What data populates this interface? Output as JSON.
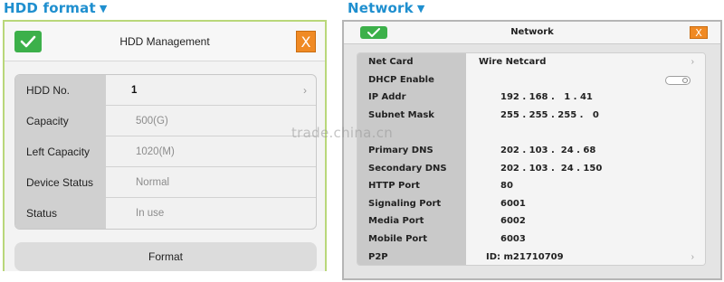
{
  "captions": {
    "hdd": "HDD format",
    "network": "Network",
    "arrow_glyph": "▼"
  },
  "hdd_panel": {
    "title": "HDD Management",
    "ok_icon": "checkmark-icon",
    "close_glyph": "X",
    "rows": [
      {
        "label": "HDD No.",
        "value": "1",
        "style": "bold",
        "chevron": "›"
      },
      {
        "label": "Capacity",
        "value": "500(G)",
        "style": "dim"
      },
      {
        "label": "Left Capacity",
        "value": "1020(M)",
        "style": "dim"
      },
      {
        "label": "Device Status",
        "value": "Normal",
        "style": "dim"
      },
      {
        "label": "Status",
        "value": "In use",
        "style": "dim"
      }
    ],
    "format_button": "Format"
  },
  "network_panel": {
    "title": "Network",
    "ok_icon": "checkmark-icon",
    "close_glyph": "X",
    "rows": [
      {
        "label": "Net Card",
        "value": "Wire Netcard",
        "chevron": "›"
      },
      {
        "label": "DHCP Enable",
        "value": "",
        "toggle": true
      },
      {
        "label": "IP Addr",
        "value": "192 . 168 .   1 . 41"
      },
      {
        "label": "Subnet Mask",
        "value": "255 . 255 . 255 .   0"
      },
      {
        "label": "Primary DNS",
        "value": "202 . 103 .  24 . 68"
      },
      {
        "label": "Secondary DNS",
        "value": "202 . 103 .  24 . 150"
      },
      {
        "label": "HTTP Port",
        "value": "80"
      },
      {
        "label": "Signaling Port",
        "value": "6001"
      },
      {
        "label": "Media Port",
        "value": "6002"
      },
      {
        "label": "Mobile Port",
        "value": "6003"
      },
      {
        "label": "P2P",
        "value": "ID: m21710709",
        "chevron": "›"
      }
    ]
  },
  "watermark": "trade.china.cn",
  "colors": {
    "caption_blue": "#1f8fcf",
    "ok_green": "#3cb04a",
    "close_orange": "#f08a24",
    "hdd_border_green": "#b9d77a"
  }
}
